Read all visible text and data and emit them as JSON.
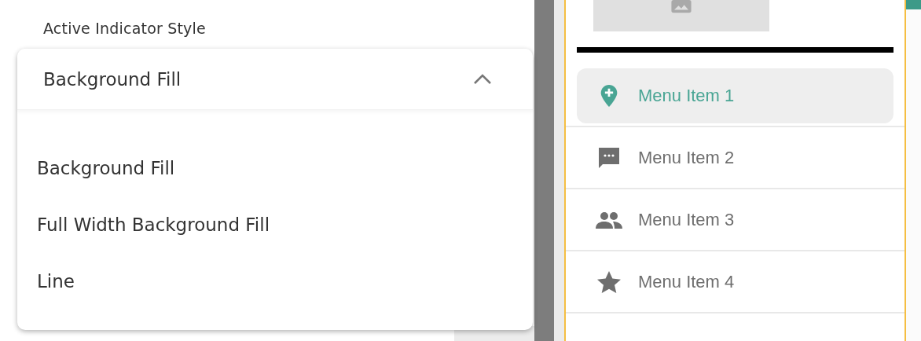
{
  "field": {
    "label": "Active Indicator Style",
    "value": "Background Fill",
    "expanded": true
  },
  "options": [
    {
      "label": "Background Fill"
    },
    {
      "label": "Full Width Background Fill"
    },
    {
      "label": "Line"
    }
  ],
  "menu_items": [
    {
      "label": "Menu Item 1",
      "kind": "pin",
      "selected": true
    },
    {
      "label": "Menu Item 2",
      "kind": "chat",
      "selected": false
    },
    {
      "label": "Menu Item 3",
      "kind": "people",
      "selected": false
    },
    {
      "label": "Menu Item 4",
      "kind": "star",
      "selected": false
    }
  ]
}
